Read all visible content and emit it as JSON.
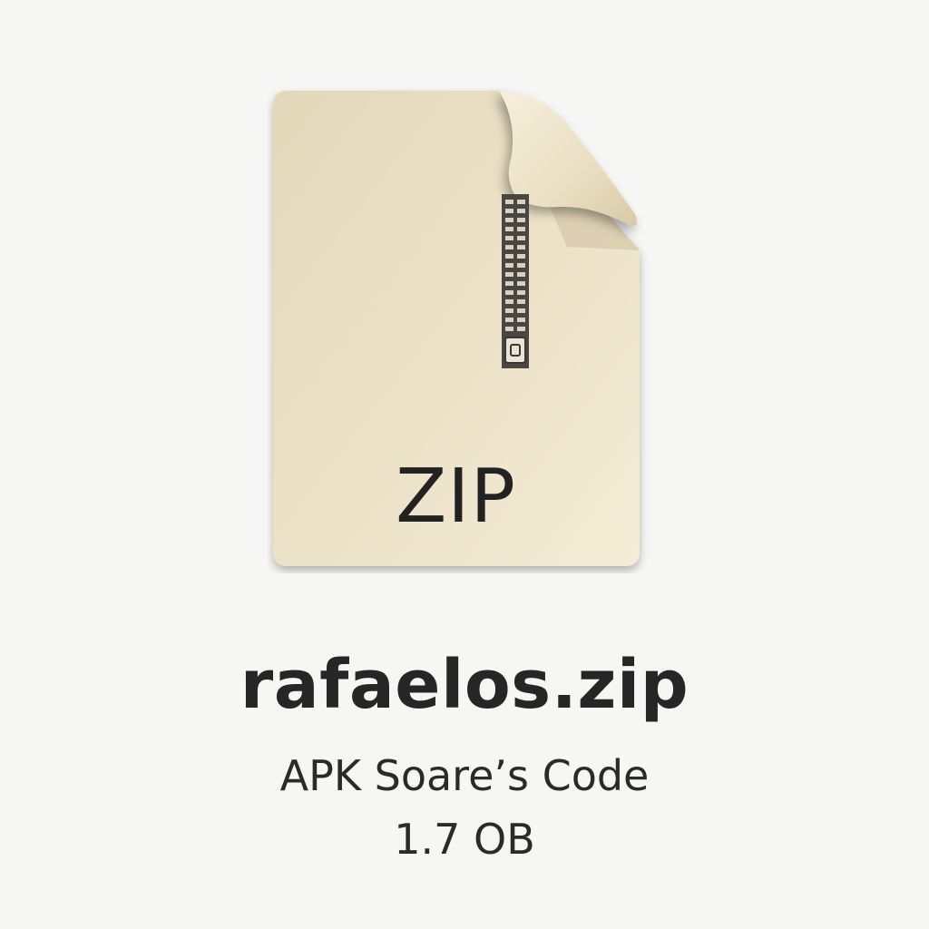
{
  "file": {
    "icon_name": "zip-file-icon",
    "extension_label": "ZIP",
    "name": "rafaelos.zip",
    "kind": "APK Soare’s Code",
    "size": "1.7 OB"
  },
  "colors": {
    "background": "#f6f6f5",
    "paper": "#e8dcc0",
    "paper_light": "#f3ead4",
    "text": "#262626"
  }
}
